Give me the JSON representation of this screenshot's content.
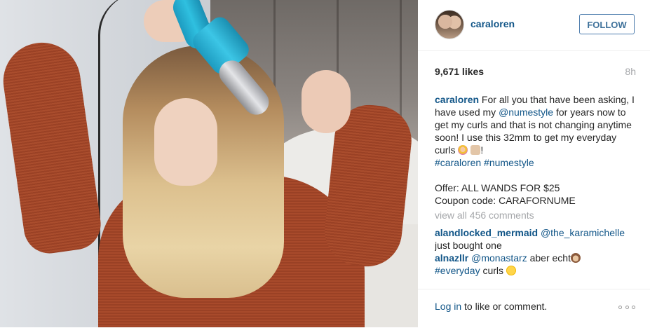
{
  "post": {
    "username": "caraloren",
    "follow_label": "FOLLOW",
    "likes": "9,671 likes",
    "time_ago": "8h"
  },
  "caption": {
    "username": "caraloren",
    "text_1": " For all you that have been asking, I have used my ",
    "mention": "@numestyle",
    "text_2": " for years now to get my curls and that is not changing anytime soon! I use this 32mm to get my everyday curls ",
    "text_3": "!",
    "hashtag_1": "#caraloren",
    "hashtag_2": "#numestyle",
    "offer_line": "Offer: ALL WANDS FOR $25",
    "coupon_line": "Coupon code: CARAFORNUME"
  },
  "view_all_comments": "view all 456 comments",
  "comments": [
    {
      "username": "alandlocked_mermaid",
      "mention": "@the_karamichelle",
      "text": "just bought one"
    },
    {
      "username": "alnazllr",
      "mention": "@monastarz",
      "text": " aber echt",
      "hashtag": "#everyday",
      "text_2": " curls "
    }
  ],
  "footer": {
    "login_link": "Log in",
    "login_text": " to like or comment."
  },
  "icons": [
    "avatar",
    "hair-salon-emoji",
    "skin-tone-emoji",
    "see-no-evil-monkey-emoji",
    "smile-emoji",
    "more-options-icon"
  ],
  "colors": {
    "link": "#125688",
    "follow_border": "#4e7dad",
    "muted": "#a5a7aa",
    "text": "#262626"
  }
}
